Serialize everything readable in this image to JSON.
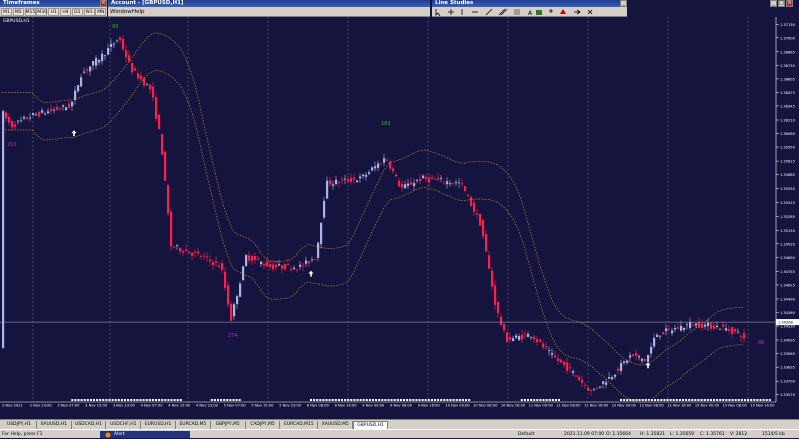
{
  "windows": {
    "timeframes": {
      "title": "Timeframes",
      "buttons": [
        "M1",
        "M5",
        "M15",
        "M30",
        "H1",
        "H4",
        "D1",
        "W1",
        "MN"
      ]
    },
    "account": {
      "title": "Account - [GBPUSD,H1]",
      "menu": [
        "Window",
        "Help"
      ]
    },
    "line_studies": {
      "title": "Line Studies"
    }
  },
  "chart": {
    "symbol_label": "GBPUSD,H1",
    "price_levels": [
      "1.37130",
      "1.37000",
      "1.36865",
      "1.36735",
      "1.36605",
      "1.36475",
      "1.36345",
      "1.36210",
      "1.36080",
      "1.35950",
      "1.35815",
      "1.35685",
      "1.35550",
      "1.35415",
      "1.35285",
      "1.35150",
      "1.35020",
      "1.34890",
      "1.34755",
      "1.34625",
      "1.34490",
      "1.34360",
      "1.34230",
      "1.34095",
      "1.33965",
      "1.33835",
      "1.33700",
      "1.33570"
    ],
    "current_price": "1.34268",
    "time_labels": [
      "2 Nov 2021",
      "2 Nov 23:00",
      "3 Nov 07:00",
      "3 Nov 15:00",
      "3 Nov 23:00",
      "4 Nov 07:00",
      "4 Nov 15:00",
      "4 Nov 23:00",
      "5 Nov 07:00",
      "5 Nov 15:00",
      "5 Nov 23:00",
      "8 Nov 08:00",
      "8 Nov 16:00",
      "9 Nov 00:00",
      "9 Nov 08:00",
      "9 Nov 16:00",
      "10 Nov 00:00",
      "10 Nov 08:00",
      "10 Nov 16:00",
      "11 Nov 00:00",
      "11 Nov 08:00",
      "11 Nov 16:00",
      "12 Nov 00:00",
      "12 Nov 08:00",
      "12 Nov 16:00",
      "15 Nov 00:00",
      "15 Nov 08:00",
      "15 Nov 16:00"
    ],
    "annotations": {
      "top_green": "93",
      "left_purple": "210",
      "mid_green": "183",
      "bottom_purple": "274",
      "right_purple": "88"
    },
    "colors": {
      "background": "#14143e",
      "bull": "#aab4e6",
      "bear": "#ff1f4a",
      "envelope": "#d08a2a",
      "grid": "#c8c8c8"
    }
  },
  "tabs": [
    "USDJPY,H1",
    "XAUUSD,H1",
    "USDCAD,H1",
    "USDCHF,H1",
    "EURUSD,H1",
    "EURCAD,M5",
    "GBPJPY,M5",
    "CADJPY,M5",
    "EURCAD,M15",
    "XAUUSD,M5",
    "GBPUSD,H1"
  ],
  "active_tab": "GBPUSD,H1",
  "status": {
    "help": "For Help, press F1",
    "alert": "Alert",
    "profile": "Default",
    "datetime": "2021.11.09 07:00",
    "open": "O: 1.35664",
    "high": "H: 1.35821",
    "low": "L: 1.35659",
    "close": "C: 1.35761",
    "volume": "V: 2812",
    "traffic": "1514/5 kb"
  }
}
